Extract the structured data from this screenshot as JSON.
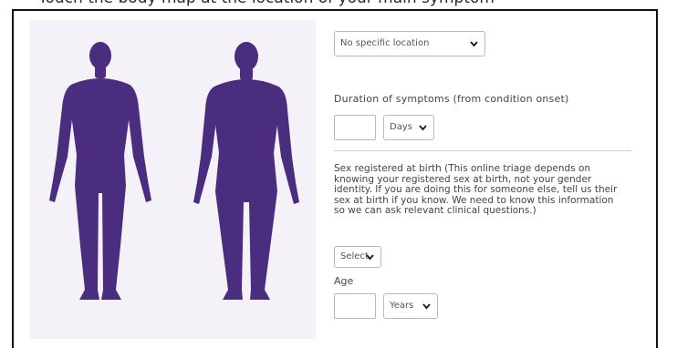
{
  "heading": "Touch the body map at the location of your main symptom",
  "location_select": {
    "selected": "No specific location"
  },
  "duration": {
    "label": "Duration of symptoms (from condition onset)",
    "value": "",
    "unit_selected": "Days"
  },
  "sex": {
    "label": "Sex registered at birth (This online triage depends on knowing your registered sex at birth, not your gender identity. If you are doing this for someone else, tell us their sex at birth if you know. We need to know this information so we can ask relevant clinical questions.)",
    "selected": "Select"
  },
  "age": {
    "label": "Age",
    "value": "",
    "unit_selected": "Years"
  },
  "colors": {
    "body_fill": "#4b2d7f",
    "panel_bg": "#f4f1f8",
    "border": "#b8b8b8"
  }
}
